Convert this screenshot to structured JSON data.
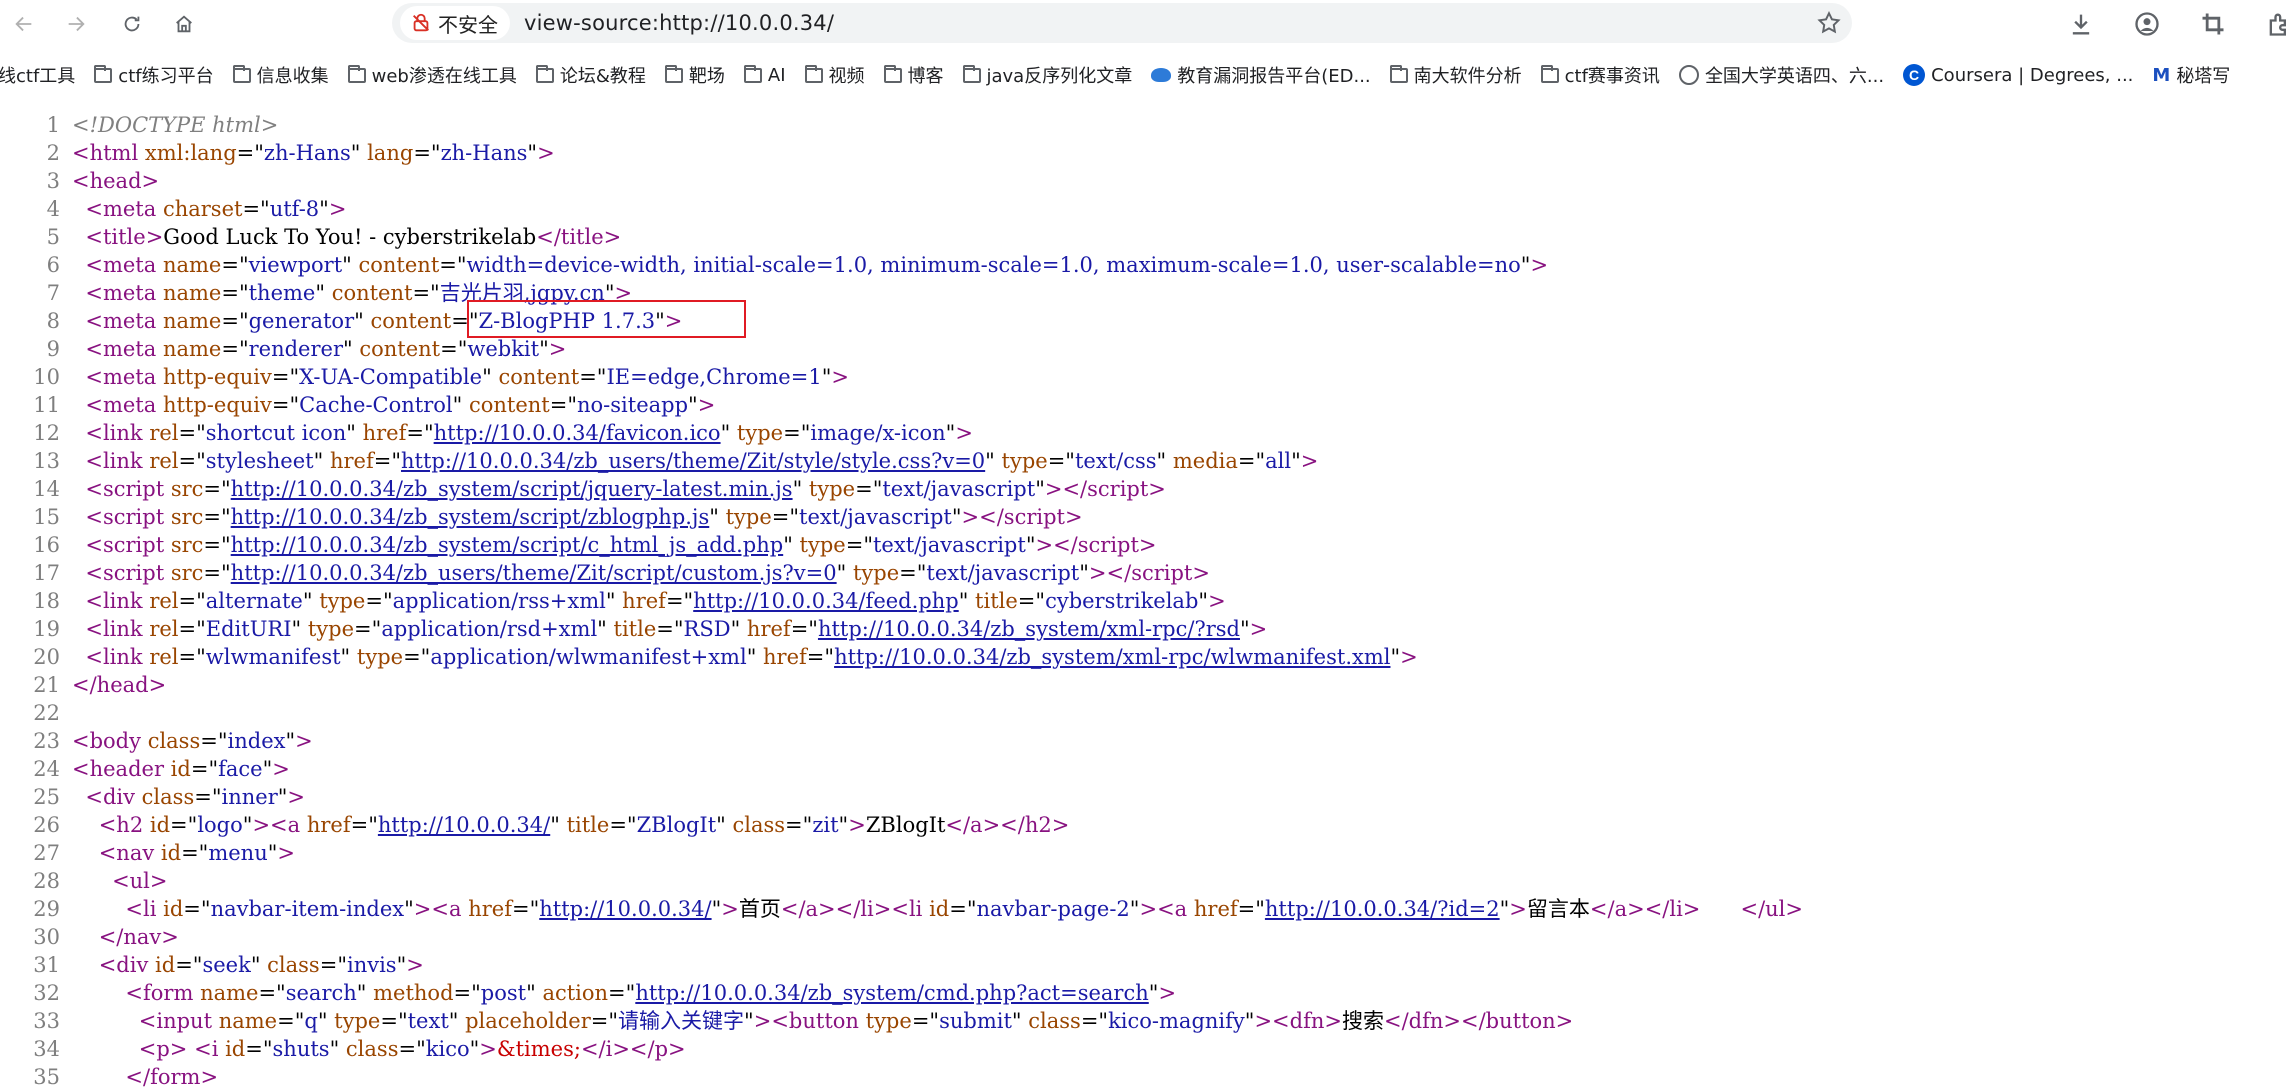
{
  "browser": {
    "security_label": "不安全",
    "url": "view-source:http://10.0.0.34/",
    "bookmarks": [
      "线ctf工具",
      "ctf练习平台",
      "信息收集",
      "web渗透在线工具",
      "论坛&教程",
      "靶场",
      "AI",
      "视频",
      "博客",
      "java反序列化文章",
      "教育漏洞报告平台(ED...",
      "南大软件分析",
      "ctf赛事资讯",
      "全国大学英语四、六...",
      "Coursera | Degrees, ...",
      "秘塔写"
    ],
    "bookmark_icons": [
      "none",
      "folder-icon",
      "folder-icon",
      "folder-icon",
      "folder-icon",
      "folder-icon",
      "folder-icon",
      "folder-icon",
      "folder-icon",
      "folder-icon",
      "bird-icon",
      "folder-icon",
      "folder-icon",
      "globe-icon",
      "coursera-icon",
      "metaso-icon"
    ]
  },
  "source": {
    "lines": [
      {
        "n": "1",
        "html": "<span class=\"dt\">&lt;!DOCTYPE html&gt;</span>"
      },
      {
        "n": "2",
        "html": "<span class=\"t\">&lt;html</span> <span class=\"an\">xml:lang</span>=\"<span class=\"av\">zh-Hans</span>\" <span class=\"an\">lang</span>=\"<span class=\"av\">zh-Hans</span>\"<span class=\"t\">&gt;</span>"
      },
      {
        "n": "3",
        "html": "<span class=\"t\">&lt;head&gt;</span>"
      },
      {
        "n": "4",
        "html": "  <span class=\"t\">&lt;meta</span> <span class=\"an\">charset</span>=\"<span class=\"av\">utf-8</span>\"<span class=\"t\">&gt;</span>"
      },
      {
        "n": "5",
        "html": "  <span class=\"t\">&lt;title&gt;</span>Good Luck To You! - cyberstrikelab<span class=\"t\">&lt;/title&gt;</span>"
      },
      {
        "n": "6",
        "html": "  <span class=\"t\">&lt;meta</span> <span class=\"an\">name</span>=\"<span class=\"av\">viewport</span>\" <span class=\"an\">content</span>=\"<span class=\"av\">width=device-width, initial-scale=1.0, minimum-scale=1.0, maximum-scale=1.0, user-scalable=no</span>\"<span class=\"t\">&gt;</span>"
      },
      {
        "n": "7",
        "html": "  <span class=\"t\">&lt;meta</span> <span class=\"an\">name</span>=\"<span class=\"av\">theme</span>\" <span class=\"an\">content</span>=\"<span class=\"av\">吉光片羽,jgpy.cn</span>\"<span class=\"t\">&gt;</span>"
      },
      {
        "n": "8",
        "html": "  <span class=\"t\">&lt;meta</span> <span class=\"an\">name</span>=\"<span class=\"av\">generator</span>\" <span class=\"an\">content</span>=\"<span class=\"av\">Z-BlogPHP 1.7.3</span>\"<span class=\"t\">&gt;</span>"
      },
      {
        "n": "9",
        "html": "  <span class=\"t\">&lt;meta</span> <span class=\"an\">name</span>=\"<span class=\"av\">renderer</span>\" <span class=\"an\">content</span>=\"<span class=\"av\">webkit</span>\"<span class=\"t\">&gt;</span>"
      },
      {
        "n": "10",
        "html": "  <span class=\"t\">&lt;meta</span> <span class=\"an\">http-equiv</span>=\"<span class=\"av\">X-UA-Compatible</span>\" <span class=\"an\">content</span>=\"<span class=\"av\">IE=edge,Chrome=1</span>\"<span class=\"t\">&gt;</span>"
      },
      {
        "n": "11",
        "html": "  <span class=\"t\">&lt;meta</span> <span class=\"an\">http-equiv</span>=\"<span class=\"av\">Cache-Control</span>\" <span class=\"an\">content</span>=\"<span class=\"av\">no-siteapp</span>\"<span class=\"t\">&gt;</span>"
      },
      {
        "n": "12",
        "html": "  <span class=\"t\">&lt;link</span> <span class=\"an\">rel</span>=\"<span class=\"av\">shortcut icon</span>\" <span class=\"an\">href</span>=\"<span class=\"lk\">http://10.0.0.34/favicon.ico</span>\" <span class=\"an\">type</span>=\"<span class=\"av\">image/x-icon</span>\"<span class=\"t\">&gt;</span>"
      },
      {
        "n": "13",
        "html": "  <span class=\"t\">&lt;link</span> <span class=\"an\">rel</span>=\"<span class=\"av\">stylesheet</span>\" <span class=\"an\">href</span>=\"<span class=\"lk\">http://10.0.0.34/zb_users/theme/Zit/style/style.css?v=0</span>\" <span class=\"an\">type</span>=\"<span class=\"av\">text/css</span>\" <span class=\"an\">media</span>=\"<span class=\"av\">all</span>\"<span class=\"t\">&gt;</span>"
      },
      {
        "n": "14",
        "html": "  <span class=\"t\">&lt;script</span> <span class=\"an\">src</span>=\"<span class=\"lk\">http://10.0.0.34/zb_system/script/jquery-latest.min.js</span>\" <span class=\"an\">type</span>=\"<span class=\"av\">text/javascript</span>\"<span class=\"t\">&gt;&lt;/script&gt;</span>"
      },
      {
        "n": "15",
        "html": "  <span class=\"t\">&lt;script</span> <span class=\"an\">src</span>=\"<span class=\"lk\">http://10.0.0.34/zb_system/script/zblogphp.js</span>\" <span class=\"an\">type</span>=\"<span class=\"av\">text/javascript</span>\"<span class=\"t\">&gt;&lt;/script&gt;</span>"
      },
      {
        "n": "16",
        "html": "  <span class=\"t\">&lt;script</span> <span class=\"an\">src</span>=\"<span class=\"lk\">http://10.0.0.34/zb_system/script/c_html_js_add.php</span>\" <span class=\"an\">type</span>=\"<span class=\"av\">text/javascript</span>\"<span class=\"t\">&gt;&lt;/script&gt;</span>"
      },
      {
        "n": "17",
        "html": "  <span class=\"t\">&lt;script</span> <span class=\"an\">src</span>=\"<span class=\"lk\">http://10.0.0.34/zb_users/theme/Zit/script/custom.js?v=0</span>\" <span class=\"an\">type</span>=\"<span class=\"av\">text/javascript</span>\"<span class=\"t\">&gt;&lt;/script&gt;</span>"
      },
      {
        "n": "18",
        "html": "  <span class=\"t\">&lt;link</span> <span class=\"an\">rel</span>=\"<span class=\"av\">alternate</span>\" <span class=\"an\">type</span>=\"<span class=\"av\">application/rss+xml</span>\" <span class=\"an\">href</span>=\"<span class=\"lk\">http://10.0.0.34/feed.php</span>\" <span class=\"an\">title</span>=\"<span class=\"av\">cyberstrikelab</span>\"<span class=\"t\">&gt;</span>"
      },
      {
        "n": "19",
        "html": "  <span class=\"t\">&lt;link</span> <span class=\"an\">rel</span>=\"<span class=\"av\">EditURI</span>\" <span class=\"an\">type</span>=\"<span class=\"av\">application/rsd+xml</span>\" <span class=\"an\">title</span>=\"<span class=\"av\">RSD</span>\" <span class=\"an\">href</span>=\"<span class=\"lk\">http://10.0.0.34/zb_system/xml-rpc/?rsd</span>\"<span class=\"t\">&gt;</span>"
      },
      {
        "n": "20",
        "html": "  <span class=\"t\">&lt;link</span> <span class=\"an\">rel</span>=\"<span class=\"av\">wlwmanifest</span>\" <span class=\"an\">type</span>=\"<span class=\"av\">application/wlwmanifest+xml</span>\" <span class=\"an\">href</span>=\"<span class=\"lk\">http://10.0.0.34/zb_system/xml-rpc/wlwmanifest.xml</span>\"<span class=\"t\">&gt;</span>"
      },
      {
        "n": "21",
        "html": "<span class=\"t\">&lt;/head&gt;</span>"
      },
      {
        "n": "22",
        "html": ""
      },
      {
        "n": "23",
        "html": "<span class=\"t\">&lt;body</span> <span class=\"an\">class</span>=\"<span class=\"av\">index</span>\"<span class=\"t\">&gt;</span>"
      },
      {
        "n": "24",
        "html": "<span class=\"t\">&lt;header</span> <span class=\"an\">id</span>=\"<span class=\"av\">face</span>\"<span class=\"t\">&gt;</span>"
      },
      {
        "n": "25",
        "html": "  <span class=\"t\">&lt;div</span> <span class=\"an\">class</span>=\"<span class=\"av\">inner</span>\"<span class=\"t\">&gt;</span>"
      },
      {
        "n": "26",
        "html": "    <span class=\"t\">&lt;h2</span> <span class=\"an\">id</span>=\"<span class=\"av\">logo</span>\"<span class=\"t\">&gt;&lt;a</span> <span class=\"an\">href</span>=\"<span class=\"lk\">http://10.0.0.34/</span>\" <span class=\"an\">title</span>=\"<span class=\"av\">ZBlogIt</span>\" <span class=\"an\">class</span>=\"<span class=\"av\">zit</span>\"<span class=\"t\">&gt;</span>ZBlogIt<span class=\"t\">&lt;/a&gt;&lt;/h2&gt;</span>"
      },
      {
        "n": "27",
        "html": "    <span class=\"t\">&lt;nav</span> <span class=\"an\">id</span>=\"<span class=\"av\">menu</span>\"<span class=\"t\">&gt;</span>"
      },
      {
        "n": "28",
        "html": "      <span class=\"t\">&lt;ul&gt;</span>"
      },
      {
        "n": "29",
        "html": "        <span class=\"t\">&lt;li</span> <span class=\"an\">id</span>=\"<span class=\"av\">navbar-item-index</span>\"<span class=\"t\">&gt;&lt;a</span> <span class=\"an\">href</span>=\"<span class=\"lk\">http://10.0.0.34/</span>\"<span class=\"t\">&gt;</span>首页<span class=\"t\">&lt;/a&gt;&lt;/li&gt;&lt;li</span> <span class=\"an\">id</span>=\"<span class=\"av\">navbar-page-2</span>\"<span class=\"t\">&gt;&lt;a</span> <span class=\"an\">href</span>=\"<span class=\"lk\">http://10.0.0.34/?id=2</span>\"<span class=\"t\">&gt;</span>留言本<span class=\"t\">&lt;/a&gt;&lt;/li&gt;</span>      <span class=\"t\">&lt;/ul&gt;</span>"
      },
      {
        "n": "30",
        "html": "    <span class=\"t\">&lt;/nav&gt;</span>"
      },
      {
        "n": "31",
        "html": "    <span class=\"t\">&lt;div</span> <span class=\"an\">id</span>=\"<span class=\"av\">seek</span>\" <span class=\"an\">class</span>=\"<span class=\"av\">invis</span>\"<span class=\"t\">&gt;</span>"
      },
      {
        "n": "32",
        "html": "        <span class=\"t\">&lt;form</span> <span class=\"an\">name</span>=\"<span class=\"av\">search</span>\" <span class=\"an\">method</span>=\"<span class=\"av\">post</span>\" <span class=\"an\">action</span>=\"<span class=\"lk\">http://10.0.0.34/zb_system/cmd.php?act=search</span>\"<span class=\"t\">&gt;</span>"
      },
      {
        "n": "33",
        "html": "          <span class=\"t\">&lt;input</span> <span class=\"an\">name</span>=\"<span class=\"av\">q</span>\" <span class=\"an\">type</span>=\"<span class=\"av\">text</span>\" <span class=\"an\">placeholder</span>=\"<span class=\"av\">请输入关键字</span>\"<span class=\"t\">&gt;&lt;button</span> <span class=\"an\">type</span>=\"<span class=\"av\">submit</span>\" <span class=\"an\">class</span>=\"<span class=\"av\">kico-magnify</span>\"<span class=\"t\">&gt;&lt;dfn&gt;</span>搜索<span class=\"t\">&lt;/dfn&gt;&lt;/button&gt;</span>"
      },
      {
        "n": "34",
        "html": "          <span class=\"t\">&lt;p&gt;</span> <span class=\"t\">&lt;i</span> <span class=\"an\">id</span>=\"<span class=\"av\">shuts</span>\" <span class=\"an\">class</span>=\"<span class=\"av\">kico</span>\"<span class=\"t\">&gt;</span><span class=\"ent\">&amp;times;</span><span class=\"t\">&lt;/i&gt;&lt;/p&gt;</span>"
      },
      {
        "n": "35",
        "html": "        <span class=\"t\">&lt;/form&gt;</span>"
      }
    ]
  },
  "colors": {
    "annotation_box": "#e01b24",
    "tag": "#881280",
    "attr_name": "#994500",
    "attr_value": "#1a1aa6"
  }
}
